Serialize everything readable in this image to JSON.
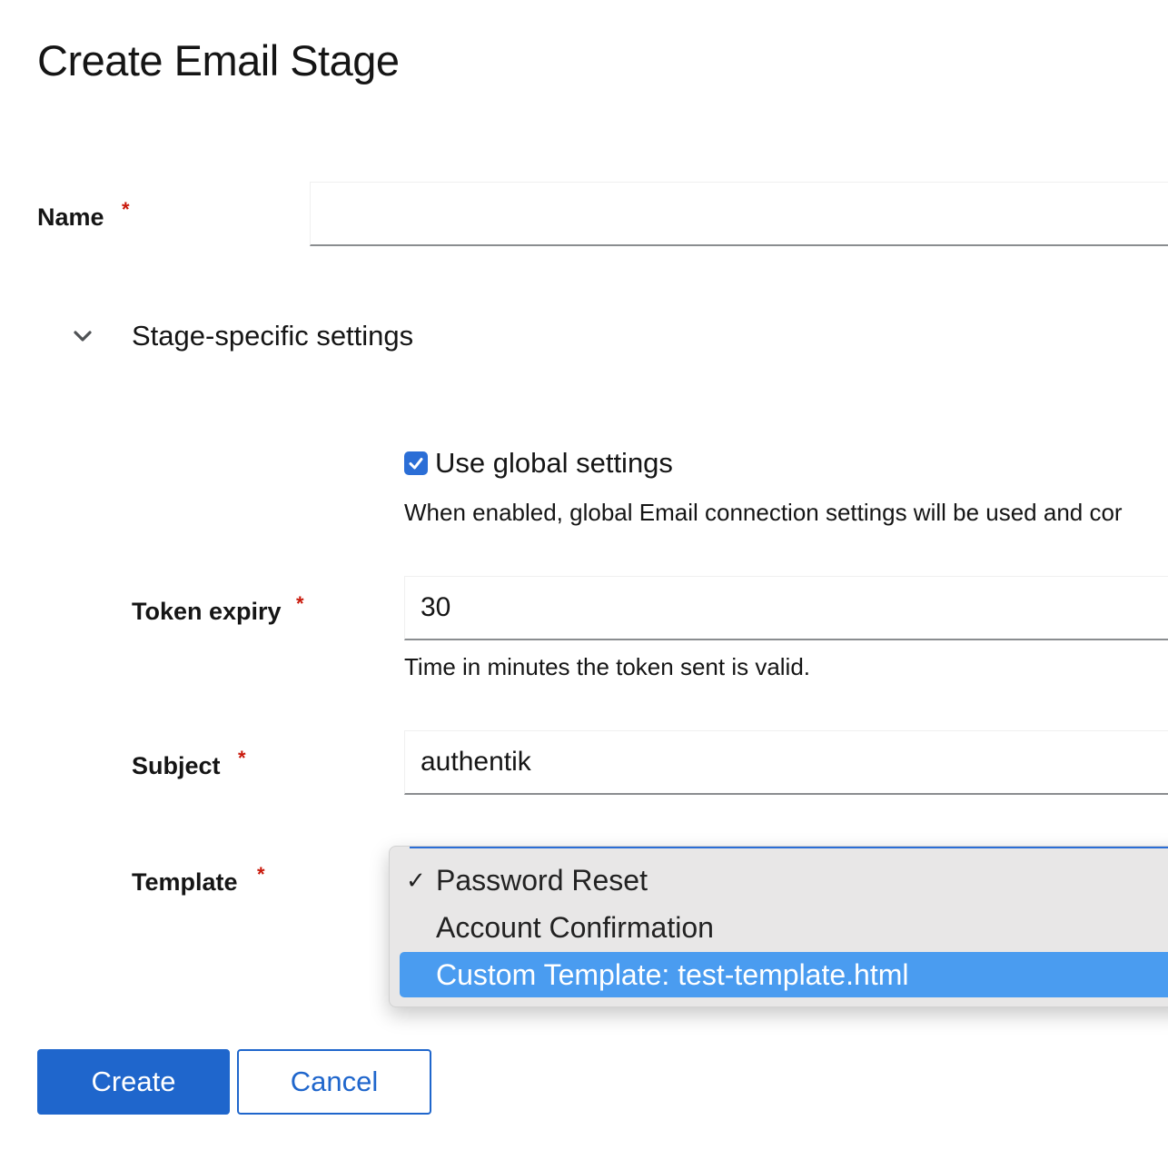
{
  "page": {
    "title": "Create Email Stage"
  },
  "form": {
    "name": {
      "label": "Name",
      "required_mark": "*",
      "value": ""
    },
    "section": {
      "title": "Stage-specific settings",
      "expanded": true,
      "icon": "chevron-down-icon"
    },
    "use_global": {
      "label": "Use global settings",
      "checked": true,
      "helper": "When enabled, global Email connection settings will be used and cor"
    },
    "token_expiry": {
      "label": "Token expiry",
      "required_mark": "*",
      "value": "30",
      "helper": "Time in minutes the token sent is valid."
    },
    "subject": {
      "label": "Subject",
      "required_mark": "*",
      "value": "authentik"
    },
    "template": {
      "label": "Template",
      "required_mark": "*",
      "options": [
        {
          "label": "Password Reset",
          "checked": true
        },
        {
          "label": "Account Confirmation",
          "checked": false
        },
        {
          "label": "Custom Template: test-template.html",
          "checked": false,
          "highlighted": true
        }
      ],
      "check_mark": "✓"
    }
  },
  "actions": {
    "create_label": "Create",
    "cancel_label": "Cancel"
  },
  "colors": {
    "primary": "#1f66cc",
    "required": "#c9190b",
    "highlight": "#4a9cf0"
  }
}
